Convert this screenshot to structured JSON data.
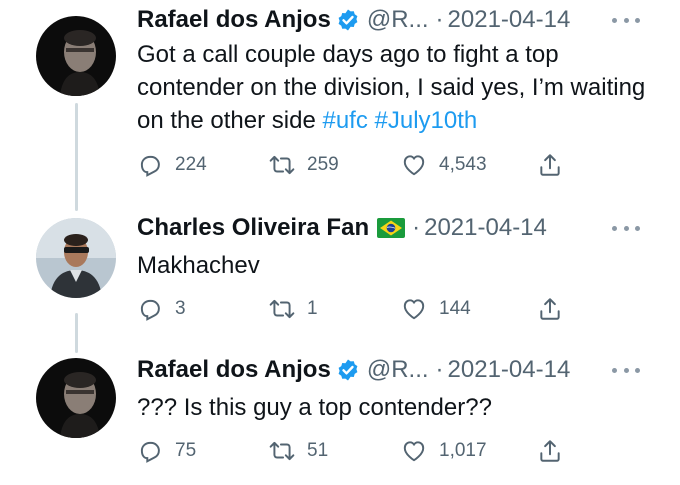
{
  "tweets": [
    {
      "name": "Rafael dos Anjos",
      "handle": "@R...",
      "separator": "·",
      "date": "2021-04-14",
      "text": "Got a call couple days ago to fight a top contender on the division, I said yes, I’m waiting on the other side",
      "hashtags": [
        "#ufc",
        "#July10th"
      ],
      "replies": "224",
      "retweets": "259",
      "likes": "4,543"
    },
    {
      "name": "Charles Oliveira Fan",
      "separator": "·",
      "date": "2021-04-14",
      "text": "Makhachev",
      "replies": "3",
      "retweets": "1",
      "likes": "144"
    },
    {
      "name": "Rafael dos Anjos",
      "handle": "@R...",
      "separator": "·",
      "date": "2021-04-14",
      "text": "??? Is this guy a top contender??",
      "replies": "75",
      "retweets": "51",
      "likes": "1,017"
    }
  ],
  "icons": {
    "reply": "reply-icon",
    "retweet": "retweet-icon",
    "like": "heart-icon",
    "share": "share-icon",
    "verified": "verified-badge-icon",
    "flag": "brazil-flag-icon",
    "more": "more-options-icon"
  },
  "colors": {
    "link": "#1d9bf0",
    "muted": "#536471",
    "verified": "#1d9bf0",
    "connector": "#cfd9de"
  }
}
